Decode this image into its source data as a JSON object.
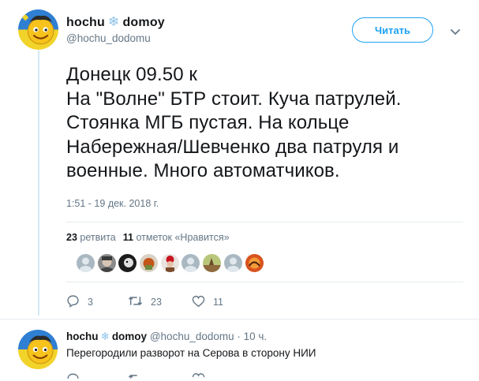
{
  "user": {
    "name_first": "hochu",
    "name_sep": "❄",
    "name_last": "domoy",
    "handle": "@hochu_dodomu"
  },
  "follow_label": "Читать",
  "tweet": {
    "lines": [
      "Донецк 09.50 к",
      "На \"Волне\" БТР стоит. Куча патрулей.",
      "Стоянка МГБ пустая. На кольце",
      "Набережная/Шевченко два патруля и",
      "военные. Много автоматчиков."
    ],
    "timestamp": "1:51 - 19 дек. 2018 г."
  },
  "stats": {
    "retweets_count": "23",
    "retweets_label": "ретвита",
    "likes_count": "11",
    "likes_label": "отметок «Нравится»"
  },
  "actions": {
    "reply_count": "3",
    "retweet_count": "23",
    "like_count": "11"
  },
  "reply": {
    "name_first": "hochu",
    "name_sep": "❄",
    "name_last": "domoy",
    "handle_time": "@hochu_dodomu · 10 ч.",
    "text": "Перегородили разворот на Серова в сторону НИИ"
  },
  "colors": {
    "accent": "#1da1f2",
    "muted": "#657786",
    "thread_line": "#d1e9f6",
    "snowflake": "#8cc0e8"
  },
  "icons": [
    "chevron-down-icon",
    "reply-icon",
    "retweet-icon",
    "heart-icon",
    "snowflake-icon"
  ]
}
